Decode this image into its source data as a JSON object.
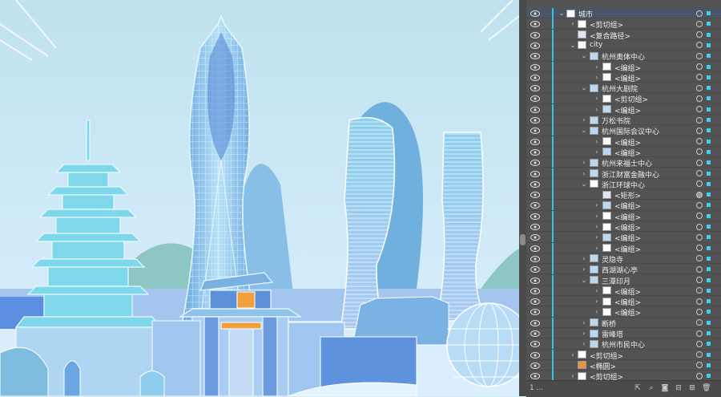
{
  "layers": [
    {
      "label": "城市",
      "depth": 0,
      "expanded": true,
      "thumb": "white",
      "selected": true
    },
    {
      "label": "<剪切组>",
      "depth": 1,
      "expanded": false,
      "thumb": "white"
    },
    {
      "label": "<复合路径>",
      "depth": 1,
      "expanded": null,
      "thumb": "line"
    },
    {
      "label": "city",
      "depth": 1,
      "expanded": true,
      "thumb": "white"
    },
    {
      "label": "杭州奥体中心",
      "depth": 2,
      "expanded": true,
      "thumb": "art"
    },
    {
      "label": "<编组>",
      "depth": 3,
      "expanded": false,
      "thumb": "white"
    },
    {
      "label": "<编组>",
      "depth": 3,
      "expanded": false,
      "thumb": "white"
    },
    {
      "label": "杭州大剧院",
      "depth": 2,
      "expanded": true,
      "thumb": "art"
    },
    {
      "label": "<剪切组>",
      "depth": 3,
      "expanded": false,
      "thumb": "white"
    },
    {
      "label": "<编组>",
      "depth": 3,
      "expanded": false,
      "thumb": "art"
    },
    {
      "label": "万松书院",
      "depth": 2,
      "expanded": false,
      "thumb": "art"
    },
    {
      "label": "杭州国际会议中心",
      "depth": 2,
      "expanded": true,
      "thumb": "art"
    },
    {
      "label": "<编组>",
      "depth": 3,
      "expanded": false,
      "thumb": "white"
    },
    {
      "label": "<编组>",
      "depth": 3,
      "expanded": false,
      "thumb": "art"
    },
    {
      "label": "杭州来福士中心",
      "depth": 2,
      "expanded": false,
      "thumb": "art"
    },
    {
      "label": "浙江财富金融中心",
      "depth": 2,
      "expanded": false,
      "thumb": "art"
    },
    {
      "label": "浙江环球中心",
      "depth": 2,
      "expanded": true,
      "thumb": "white"
    },
    {
      "label": "<矩形>",
      "depth": 3,
      "expanded": null,
      "thumb": "line"
    },
    {
      "label": "<编组>",
      "depth": 3,
      "expanded": false,
      "thumb": "art"
    },
    {
      "label": "<编组>",
      "depth": 3,
      "expanded": false,
      "thumb": "white"
    },
    {
      "label": "<编组>",
      "depth": 3,
      "expanded": false,
      "thumb": "white"
    },
    {
      "label": "<编组>",
      "depth": 3,
      "expanded": false,
      "thumb": "art"
    },
    {
      "label": "<编组>",
      "depth": 3,
      "expanded": false,
      "thumb": "white"
    },
    {
      "label": "灵隐寺",
      "depth": 2,
      "expanded": false,
      "thumb": "art"
    },
    {
      "label": "西湖湖心亭",
      "depth": 2,
      "expanded": false,
      "thumb": "art"
    },
    {
      "label": "三潭印月",
      "depth": 2,
      "expanded": true,
      "thumb": "art"
    },
    {
      "label": "<编组>",
      "depth": 3,
      "expanded": false,
      "thumb": "white"
    },
    {
      "label": "<编组>",
      "depth": 3,
      "expanded": false,
      "thumb": "white"
    },
    {
      "label": "<编组>",
      "depth": 3,
      "expanded": false,
      "thumb": "white"
    },
    {
      "label": "断桥",
      "depth": 2,
      "expanded": false,
      "thumb": "art"
    },
    {
      "label": "雷峰塔",
      "depth": 2,
      "expanded": false,
      "thumb": "art"
    },
    {
      "label": "杭州市民中心",
      "depth": 2,
      "expanded": false,
      "thumb": "art"
    },
    {
      "label": "<剪切组>",
      "depth": 1,
      "expanded": false,
      "thumb": "white"
    },
    {
      "label": "<椭圆>",
      "depth": 1,
      "expanded": null,
      "thumb": "orange"
    },
    {
      "label": "<剪切组>",
      "depth": 1,
      "expanded": false,
      "thumb": "white"
    }
  ],
  "colors": {
    "accent": "#37c3e6",
    "panel_bg": "#535353",
    "sky_top": "#bfe2ee",
    "sky_bottom": "#dcefff"
  },
  "bottom_bar": {
    "status": "1 ...",
    "icons": [
      "export-icon",
      "search-icon",
      "clip-mask-icon",
      "sublayer-icon",
      "new-layer-icon",
      "trash-icon"
    ]
  }
}
